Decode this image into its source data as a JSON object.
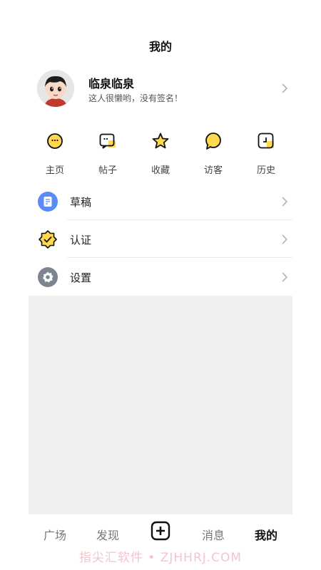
{
  "header": {
    "title": "我的"
  },
  "profile": {
    "name": "临泉临泉",
    "signature": "这人很懒哟，没有签名！"
  },
  "shortcuts": [
    {
      "label": "主页",
      "icon": "home-face-icon"
    },
    {
      "label": "帖子",
      "icon": "posts-chat-icon"
    },
    {
      "label": "收藏",
      "icon": "favorite-star-icon"
    },
    {
      "label": "访客",
      "icon": "visitor-bubble-icon"
    },
    {
      "label": "历史",
      "icon": "history-icon"
    }
  ],
  "menu": [
    {
      "label": "草稿",
      "icon": "draft-icon"
    },
    {
      "label": "认证",
      "icon": "certification-badge-icon"
    },
    {
      "label": "设置",
      "icon": "settings-gear-icon"
    }
  ],
  "tabs": [
    {
      "label": "广场"
    },
    {
      "label": "发现"
    },
    {
      "label": "",
      "icon": "add-post-icon"
    },
    {
      "label": "消息"
    },
    {
      "label": "我的",
      "active": true
    }
  ],
  "watermark": "指尖汇软件 • ZJHHRJ.COM",
  "colors": {
    "accent_yellow": "#ffd84d",
    "draft_blue": "#5b8cf5",
    "settings_grey": "#7d8590",
    "background_grey": "#f0f0f0"
  }
}
